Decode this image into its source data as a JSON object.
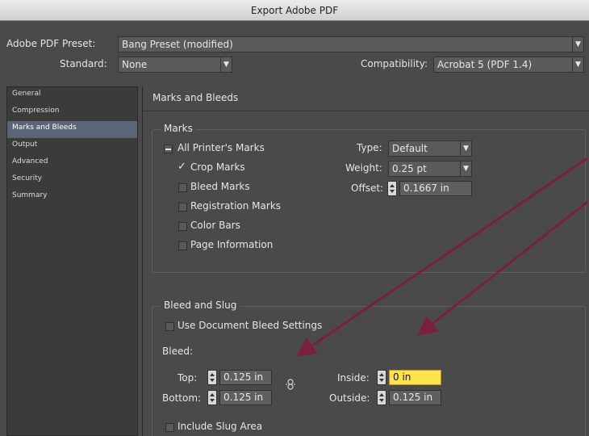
{
  "window": {
    "title": "Export Adobe PDF"
  },
  "preset": {
    "label": "Adobe PDF Preset:",
    "value": "Bang Preset (modified)"
  },
  "standard": {
    "label": "Standard:",
    "value": "None"
  },
  "compatibility": {
    "label": "Compatibility:",
    "value": "Acrobat 5 (PDF 1.4)"
  },
  "sidebar": {
    "items": [
      {
        "label": "General",
        "selected": false
      },
      {
        "label": "Compression",
        "selected": false
      },
      {
        "label": "Marks and Bleeds",
        "selected": true
      },
      {
        "label": "Output",
        "selected": false
      },
      {
        "label": "Advanced",
        "selected": false
      },
      {
        "label": "Security",
        "selected": false
      },
      {
        "label": "Summary",
        "selected": false
      }
    ]
  },
  "section": {
    "title": "Marks and Bleeds"
  },
  "marks": {
    "group_title": "Marks",
    "all_printers_marks": "All Printer's Marks",
    "crop_marks": "Crop Marks",
    "bleed_marks": "Bleed Marks",
    "registration_marks": "Registration Marks",
    "color_bars": "Color Bars",
    "page_information": "Page Information",
    "type": {
      "label": "Type:",
      "value": "Default"
    },
    "weight": {
      "label": "Weight:",
      "value": "0.25 pt"
    },
    "offset": {
      "label": "Offset:",
      "value": "0.1667 in"
    }
  },
  "bleed_slug": {
    "group_title": "Bleed and Slug",
    "use_document_bleed": "Use Document Bleed Settings",
    "bleed_label": "Bleed:",
    "top": {
      "label": "Top:",
      "value": "0.125 in"
    },
    "bottom": {
      "label": "Bottom:",
      "value": "0.125 in"
    },
    "inside": {
      "label": "Inside:",
      "value": "0 in"
    },
    "outside": {
      "label": "Outside:",
      "value": "0.125 in"
    },
    "include_slug": "Include Slug Area"
  },
  "colors": {
    "annotation_arrow": "#7a1f3d",
    "selected_item": "#5a6678",
    "focused_field": "#ffe34a"
  }
}
